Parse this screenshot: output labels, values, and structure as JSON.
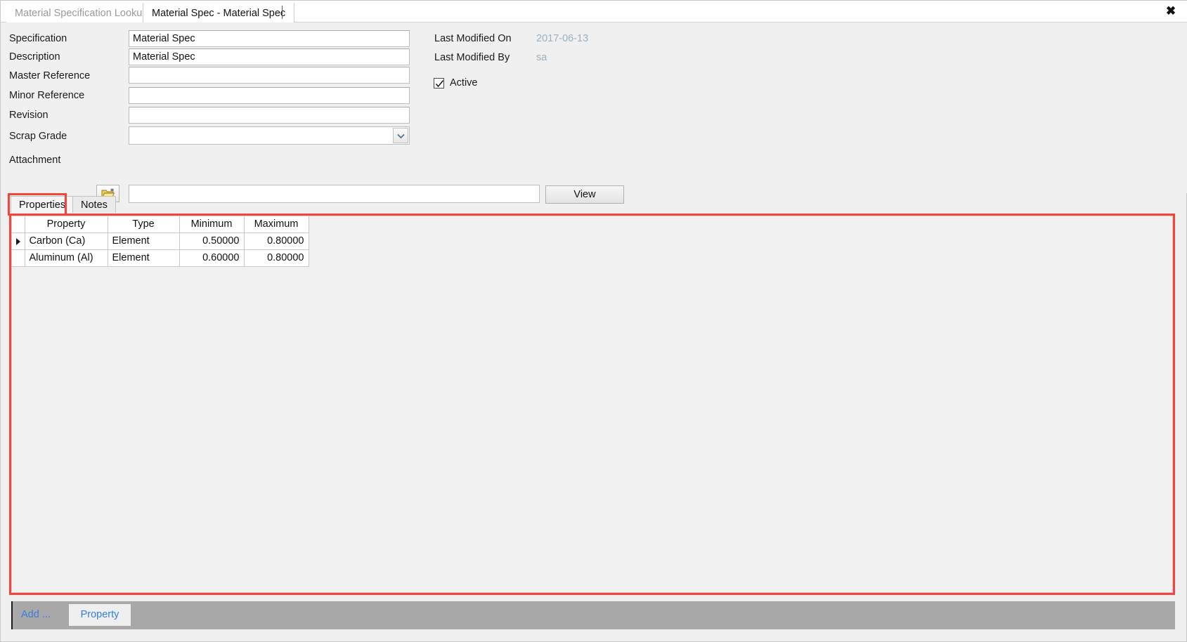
{
  "window": {
    "close_label": "✖"
  },
  "tabs": [
    {
      "label": "Material Specification Lookup",
      "active": false
    },
    {
      "label": "Material Spec - Material Spec",
      "active": true
    }
  ],
  "form": {
    "fields": [
      {
        "label": "Specification",
        "value": "Material Spec",
        "placeholder": ""
      },
      {
        "label": "Description",
        "value": "Material Spec",
        "placeholder": ""
      },
      {
        "label": "Master Reference",
        "value": "",
        "placeholder": ""
      },
      {
        "label": "Minor Reference",
        "value": "",
        "placeholder": ""
      },
      {
        "label": "Revision",
        "value": "",
        "placeholder": ""
      }
    ],
    "scrap_grade": {
      "label": "Scrap Grade",
      "value": "",
      "placeholder": ""
    },
    "attachment": {
      "label": "Attachment",
      "value": "",
      "placeholder": "",
      "browse_icon": "open-folder-icon",
      "view_label": "View"
    }
  },
  "meta": {
    "last_modified_on_label": "Last Modified On",
    "last_modified_on_value": "2017-06-13",
    "last_modified_by_label": "Last Modified By",
    "last_modified_by_value": "sa",
    "active_label": "Active",
    "active_checked": true
  },
  "inner_tabs": [
    {
      "label": "Properties",
      "selected": true
    },
    {
      "label": "Notes",
      "selected": false
    }
  ],
  "grid": {
    "columns": [
      "Property",
      "Type",
      "Minimum",
      "Maximum"
    ],
    "rows": [
      {
        "selected": true,
        "property": "Carbon (Ca)",
        "type": "Element",
        "minimum": "0.50000",
        "maximum": "0.80000"
      },
      {
        "selected": false,
        "property": "Aluminum (Al)",
        "type": "Element",
        "minimum": "0.60000",
        "maximum": "0.80000"
      }
    ]
  },
  "bottom_bar": {
    "add_label": "Add ...",
    "property_label": "Property"
  },
  "colors": {
    "highlight": "#f4453c",
    "link": "#3e7cd6",
    "meta_value": "#9bb0c4",
    "toolbar_bg": "#a8a8a8"
  }
}
